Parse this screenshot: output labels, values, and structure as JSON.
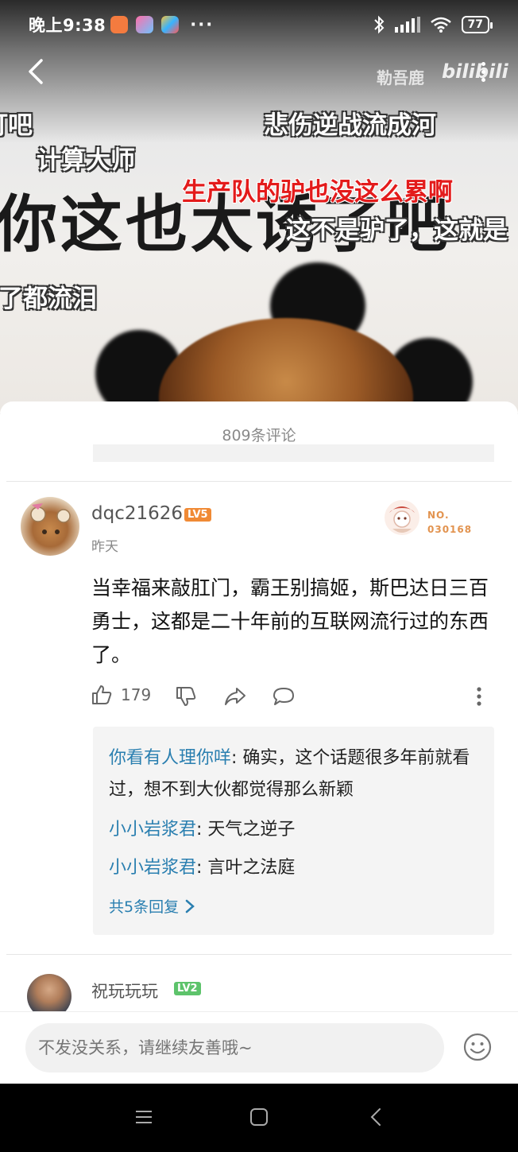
{
  "status_bar": {
    "time": "晚上9:38",
    "dots": "···",
    "battery": "77"
  },
  "video": {
    "watermark_text": "勒吾鹿",
    "watermark_logo": "bilibili",
    "meme_caption": "你这也太诱了吧",
    "danmaku": [
      {
        "text": "路灯吧",
        "color": "white"
      },
      {
        "text": "悲伤逆战流成河",
        "color": "white"
      },
      {
        "text": "计算大师",
        "color": "white"
      },
      {
        "text": "生产队的驴也没这么累啊",
        "color": "red"
      },
      {
        "text": "这不是驴了，这就是",
        "color": "white"
      },
      {
        "text": "了都流泪",
        "color": "white"
      }
    ]
  },
  "comments_panel": {
    "title": "809条评论",
    "comment": {
      "username": "dqc21626",
      "level": "LV5",
      "level_color": "#f08a35",
      "time": "昨天",
      "badge_no_label": "NO.",
      "badge_no_value": "030168",
      "content": "当幸福来敲肛门，霸王别搞姬，斯巴达日三百勇士，这都是二十年前的互联网流行过的东西了。",
      "likes": "179",
      "replies": [
        {
          "name": "你看有人理你咩",
          "sep": ": ",
          "text": "确实，这个话题很多年前就看过，想不到大伙都觉得那么新颖"
        },
        {
          "name": "小小岩浆君",
          "sep": ": ",
          "text": "天气之逆子"
        },
        {
          "name": "小小岩浆君",
          "sep": ": ",
          "text": "言叶之法庭"
        }
      ],
      "more_replies": "共5条回复"
    },
    "next_comment": {
      "username": "祝玩玩玩",
      "level": "LV2",
      "level_color": "#5dc36b"
    }
  },
  "input": {
    "placeholder": "不发没关系，请继续友善哦~"
  },
  "colors": {
    "accent_link": "#2a7fb0",
    "danmaku_red": "#e31b1b"
  }
}
